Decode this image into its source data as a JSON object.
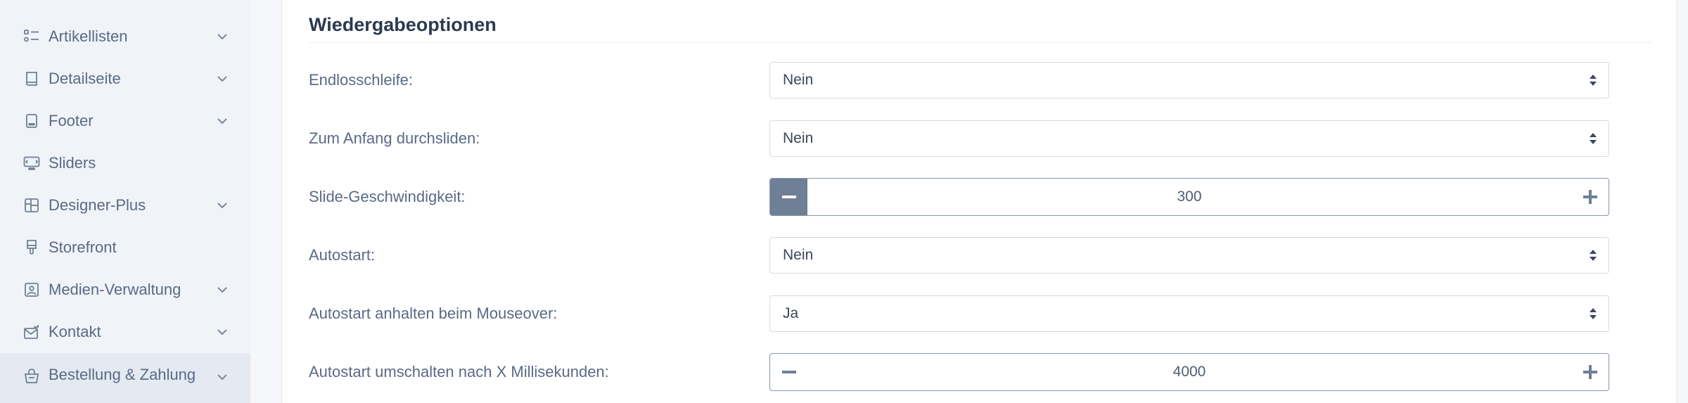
{
  "sidebar": {
    "items": [
      {
        "label": "Artikellisten",
        "icon": "list-icon",
        "has_chevron": true
      },
      {
        "label": "Detailseite",
        "icon": "book-icon",
        "has_chevron": true
      },
      {
        "label": "Footer",
        "icon": "footer-icon",
        "has_chevron": true
      },
      {
        "label": "Sliders",
        "icon": "slider-icon",
        "has_chevron": false
      },
      {
        "label": "Designer-Plus",
        "icon": "layout-icon",
        "has_chevron": true
      },
      {
        "label": "Storefront",
        "icon": "brush-icon",
        "has_chevron": false
      },
      {
        "label": "Medien-Verwaltung",
        "icon": "image-icon",
        "has_chevron": true
      },
      {
        "label": "Kontakt",
        "icon": "mail-icon",
        "has_chevron": true
      },
      {
        "label": "Bestellung & Zahlung",
        "icon": "basket-icon",
        "has_chevron": true,
        "active": true
      }
    ]
  },
  "section": {
    "title": "Wiedergabeoptionen"
  },
  "form": {
    "loop": {
      "label": "Endlosschleife:",
      "value": "Nein"
    },
    "rewind": {
      "label": "Zum Anfang durchsliden:",
      "value": "Nein"
    },
    "speed": {
      "label": "Slide-Geschwindigkeit:",
      "value": "300"
    },
    "autoplay": {
      "label": "Autostart:",
      "value": "Nein"
    },
    "pause_on_hover": {
      "label": "Autostart anhalten beim Mouseover:",
      "value": "Ja"
    },
    "autoplay_interval": {
      "label": "Autostart umschalten nach X Millisekunden:",
      "value": "4000"
    }
  },
  "colors": {
    "sidebar_bg": "#f0f3f8",
    "sidebar_active_bg": "#e4e9f2",
    "text_muted": "#5a6a85",
    "stepper_button_active": "#6f7f96"
  }
}
